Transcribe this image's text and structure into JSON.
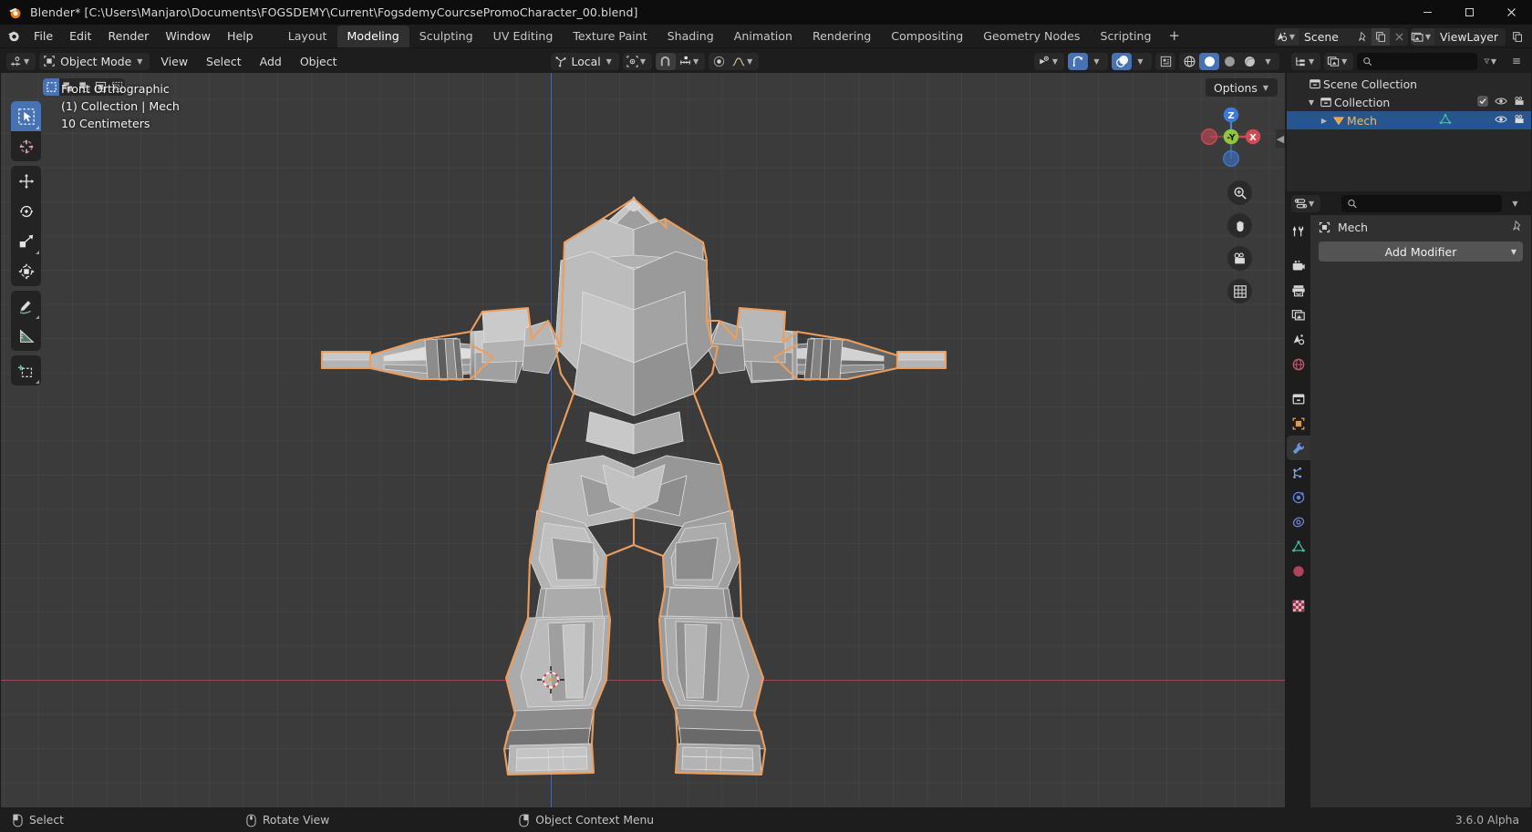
{
  "window": {
    "title": "Blender* [C:\\Users\\Manjaro\\Documents\\FOGSDEMY\\Current\\FogsdemyCourcsePromoCharacter_00.blend]",
    "minimize": "—",
    "maximize": "▢",
    "close": "✕"
  },
  "topbar": {
    "menus": [
      "File",
      "Edit",
      "Render",
      "Window",
      "Help"
    ],
    "workspaces": [
      {
        "label": "Layout",
        "active": false
      },
      {
        "label": "Modeling",
        "active": true
      },
      {
        "label": "Sculpting",
        "active": false
      },
      {
        "label": "UV Editing",
        "active": false
      },
      {
        "label": "Texture Paint",
        "active": false
      },
      {
        "label": "Shading",
        "active": false
      },
      {
        "label": "Animation",
        "active": false
      },
      {
        "label": "Rendering",
        "active": false
      },
      {
        "label": "Compositing",
        "active": false
      },
      {
        "label": "Geometry Nodes",
        "active": false
      },
      {
        "label": "Scripting",
        "active": false
      }
    ],
    "add_workspace": "+",
    "scene": {
      "name": "Scene",
      "icon": "scene-icon",
      "new_label": "",
      "unlink_label": ""
    },
    "viewlayer": {
      "name": "ViewLayer",
      "icon": "viewlayer-icon"
    }
  },
  "viewport_header": {
    "editor_type_icon": "editor-type-icon",
    "mode": "Object Mode",
    "menus": [
      "View",
      "Select",
      "Add",
      "Object"
    ],
    "transform_orientation": "Local",
    "pivot_icon": "pivot-point-icon",
    "snap_icon": "magnet-icon",
    "snap_target_icon": "snap-increment-icon",
    "proportional_icon": "proportional-edit-icon",
    "falloff_icon": "falloff-smooth-icon",
    "visibility_icon": "object-visibility-icon",
    "gizmo_icon": "gizmo-icon",
    "overlays_icon": "overlays-icon",
    "xray_icon": "xray-toggle-icon",
    "shading_modes": [
      "wireframe",
      "solid",
      "material-preview",
      "rendered"
    ],
    "shading_active": "solid",
    "options_label": "Options"
  },
  "viewport": {
    "view_name": "Front Orthographic",
    "collection_line": "(1) Collection | Mech",
    "grid_scale": "10 Centimeters",
    "gizmo_axes": {
      "x": "X",
      "y": "-Y",
      "z": "Z"
    },
    "colors": {
      "background": "#3b3b3b",
      "selection_outline": "#ed9e5c",
      "axis_x": "#e0555a",
      "axis_z": "#5082dc",
      "accent_blue": "#4772b3"
    },
    "tools": [
      {
        "name": "tweak-select-tool",
        "active": true
      },
      {
        "name": "cursor-tool",
        "active": false
      },
      {
        "name": "move-tool",
        "active": false
      },
      {
        "name": "rotate-tool",
        "active": false
      },
      {
        "name": "scale-tool",
        "active": false
      },
      {
        "name": "transform-tool",
        "active": false
      },
      {
        "name": "annotate-tool",
        "active": false
      },
      {
        "name": "measure-tool",
        "active": false
      },
      {
        "name": "add-cube-tool",
        "active": false
      }
    ],
    "select_modes": [
      {
        "name": "select-box",
        "active": true
      },
      {
        "name": "select-extend",
        "active": false
      },
      {
        "name": "select-subtract",
        "active": false
      },
      {
        "name": "select-invert",
        "active": false
      },
      {
        "name": "select-intersect",
        "active": false
      }
    ],
    "nav_icons": [
      "zoom-icon",
      "pan-hand-icon",
      "camera-icon",
      "grid-ortho-icon"
    ]
  },
  "outliner": {
    "display_mode_icon": "outliner-display-mode-icon",
    "filter_icon": "filter-icon",
    "search_placeholder": "",
    "search_value": "",
    "rows": [
      {
        "label": "Scene Collection",
        "icon": "collection-icon",
        "indent": 0,
        "selected": false,
        "twisty": "",
        "object": false,
        "checkbox": false,
        "eye": false,
        "camera": false
      },
      {
        "label": "Collection",
        "icon": "collection-icon",
        "indent": 1,
        "selected": false,
        "twisty": "▼",
        "object": false,
        "checkbox": true,
        "eye": true,
        "camera": true
      },
      {
        "label": "Mech",
        "icon": "mesh-object-icon",
        "indent": 2,
        "selected": true,
        "twisty": "▶",
        "object": true,
        "checkbox": false,
        "eye": true,
        "camera": true
      }
    ]
  },
  "properties": {
    "editor_icon": "properties-editor-icon",
    "search_value": "",
    "breadcrumb_object": "Mech",
    "breadcrumb_icon": "object-icon",
    "pin_icon": "pin-icon",
    "add_modifier_label": "Add Modifier",
    "tabs": [
      {
        "name": "tool-tab",
        "icon": "tool-icon",
        "active": false
      },
      {
        "name": "render-tab",
        "icon": "render-camera-icon",
        "active": false
      },
      {
        "name": "output-tab",
        "icon": "printer-icon",
        "active": false
      },
      {
        "name": "viewlayer-tab",
        "icon": "images-icon",
        "active": false
      },
      {
        "name": "scene-tab",
        "icon": "scene-cone-icon",
        "active": false
      },
      {
        "name": "world-tab",
        "icon": "world-globe-icon",
        "active": false
      },
      {
        "name": "collection-tab",
        "icon": "collection-box-icon",
        "active": false
      },
      {
        "name": "object-tab",
        "icon": "object-square-icon",
        "active": false
      },
      {
        "name": "modifier-tab",
        "icon": "wrench-icon",
        "active": true
      },
      {
        "name": "particles-tab",
        "icon": "particles-icon",
        "active": false
      },
      {
        "name": "physics-tab",
        "icon": "physics-orbit-icon",
        "active": false
      },
      {
        "name": "constraints-tab",
        "icon": "constraint-icon",
        "active": false
      },
      {
        "name": "data-tab",
        "icon": "mesh-data-triangle-icon",
        "active": false
      },
      {
        "name": "material-tab",
        "icon": "material-sphere-icon",
        "active": false
      },
      {
        "name": "texture-tab",
        "icon": "texture-checker-icon",
        "active": false
      }
    ]
  },
  "statusbar": {
    "items": [
      {
        "icon": "mouse-left-icon",
        "label": "Select"
      },
      {
        "icon": "mouse-middle-icon",
        "label": "Rotate View"
      },
      {
        "icon": "mouse-right-icon",
        "label": "Object Context Menu"
      }
    ],
    "version": "3.6.0 Alpha"
  }
}
